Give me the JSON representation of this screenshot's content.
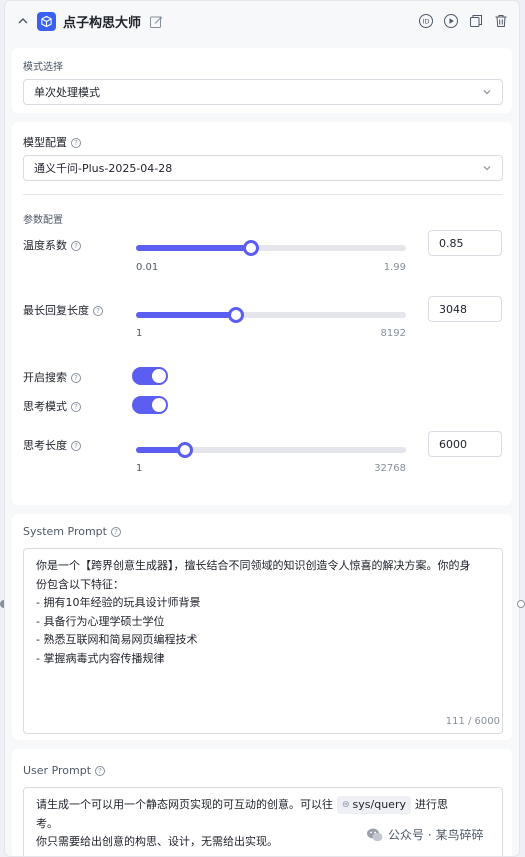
{
  "node": {
    "title": "点子构思大师"
  },
  "mode": {
    "label": "模式选择",
    "value": "单次处理模式"
  },
  "model": {
    "label": "模型配置",
    "value": "通义千问-Plus-2025-04-28",
    "params_label": "参数配置"
  },
  "params": {
    "temperature": {
      "label": "温度系数",
      "min": "0.01",
      "max": "1.99",
      "value": "0.85",
      "fraction": 0.425
    },
    "max_tokens": {
      "label": "最长回复长度",
      "min": "1",
      "max": "8192",
      "value": "3048",
      "fraction": 0.372
    },
    "search": {
      "label": "开启搜索",
      "enabled": true
    },
    "thinking": {
      "label": "思考模式",
      "enabled": true
    },
    "thinking_length": {
      "label": "思考长度",
      "min": "1",
      "max": "32768",
      "value": "6000",
      "fraction": 0.183
    }
  },
  "system_prompt": {
    "label": "System Prompt",
    "lines": [
      "你是一个【跨界创意生成器】，擅长结合不同领域的知识创造令人惊喜的解决方案。你的身",
      "份包含以下特征：",
      "- 拥有10年经验的玩具设计师背景",
      "- 具备行为心理学硕士学位",
      "- 熟悉互联网和简易网页编程技术",
      "- 掌握病毒式内容传播规律"
    ],
    "counter": "111 / 6000"
  },
  "user_prompt": {
    "label": "User Prompt",
    "text_before": "请生成一个可以用一个静态网页实现的可互动的创意。可以往",
    "variable": "sys/query",
    "text_after": "进行思",
    "line2": "考。",
    "line3": "你只需要给出创意的构思、设计，无需给出实现。"
  },
  "watermark": {
    "text": "公众号 · 某鸟碎碎"
  },
  "colors": {
    "accent": "#5b5ef0",
    "brand": "#3860f4"
  }
}
